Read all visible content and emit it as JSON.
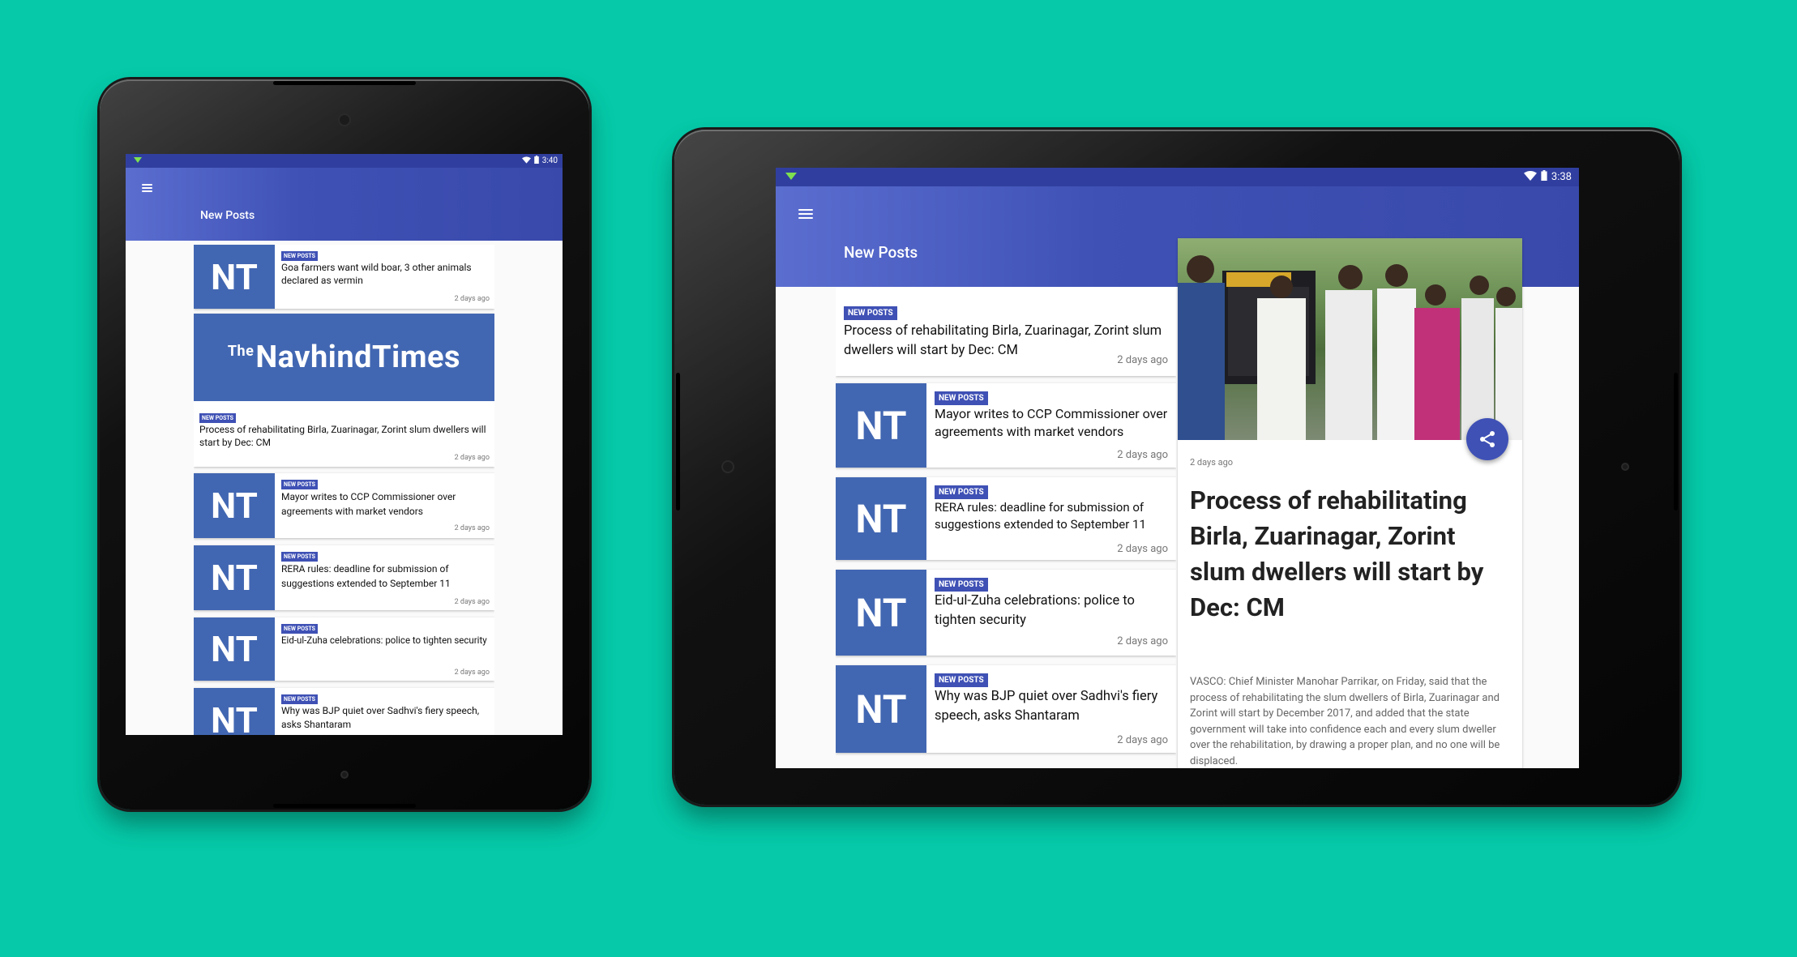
{
  "small_tablet": {
    "status_time": "3:40",
    "app_title": "New Posts",
    "banner_logo": {
      "prefix": "The",
      "name": "NavhindTimes"
    },
    "posts": [
      {
        "logo": "NT",
        "badge": "NEW POSTS",
        "headline": "Goa farmers want wild boar, 3 other animals declared as vermin",
        "time": "2 days ago"
      },
      {
        "logo": "",
        "badge": "NEW POSTS",
        "headline": "Process of rehabilitating Birla, Zuarinagar, Zorint slum dwellers will start by Dec: CM",
        "time": "2 days ago"
      },
      {
        "logo": "NT",
        "badge": "NEW POSTS",
        "headline": "Mayor writes to CCP Commissioner over agreements with market vendors",
        "time": "2 days ago"
      },
      {
        "logo": "NT",
        "badge": "NEW POSTS",
        "headline": "RERA rules: deadline for submission of suggestions extended to September 11",
        "time": "2 days ago"
      },
      {
        "logo": "NT",
        "badge": "NEW POSTS",
        "headline": "Eid-ul-Zuha celebrations: police to tighten security",
        "time": "2 days ago"
      },
      {
        "logo": "NT",
        "badge": "NEW POSTS",
        "headline": "Why was BJP quiet over Sadhvi's fiery speech, asks Shantaram",
        "time": ""
      }
    ]
  },
  "large_tablet": {
    "status_time": "3:38",
    "app_title": "New Posts",
    "posts": [
      {
        "logo": "",
        "badge": "NEW POSTS",
        "headline": "Process of rehabilitating Birla, Zuarinagar, Zorint slum dwellers will start by Dec: CM",
        "time": "2 days ago"
      },
      {
        "logo": "NT",
        "badge": "NEW POSTS",
        "headline": "Mayor writes to CCP Commissioner over agreements with market vendors",
        "time": "2 days ago"
      },
      {
        "logo": "NT",
        "badge": "NEW POSTS",
        "headline": "RERA rules: deadline for submission of suggestions extended to September 11",
        "time": "2 days ago"
      },
      {
        "logo": "NT",
        "badge": "NEW POSTS",
        "headline": "Eid-ul-Zuha celebrations: police to tighten security",
        "time": "2 days ago"
      },
      {
        "logo": "NT",
        "badge": "NEW POSTS",
        "headline": "Why was BJP quiet over Sadhvi's fiery speech, asks Shantaram",
        "time": "2 days ago"
      }
    ],
    "detail": {
      "time": "2 days ago",
      "title": "Process of rehabilitating Birla, Zuarinagar, Zorint slum dwellers will start by Dec: CM",
      "body": "VASCO: Chief Minister Manohar Parrikar, on Friday, said that the process of rehabilitating the slum dwellers of Birla, Zuarinagar and Zorint will start by December 2017, and added that the state government will take into confidence each and every slum dweller over the rehabilitation, by drawing a proper plan, and no one will be displaced."
    }
  },
  "colors": {
    "background": "#05c9a8",
    "primary": "#3f51b5",
    "status": "#303f9f",
    "logo_blue": "#4267b2"
  },
  "icons": [
    "menu-icon",
    "wifi-icon",
    "battery-icon",
    "share-icon",
    "signal-icon"
  ]
}
